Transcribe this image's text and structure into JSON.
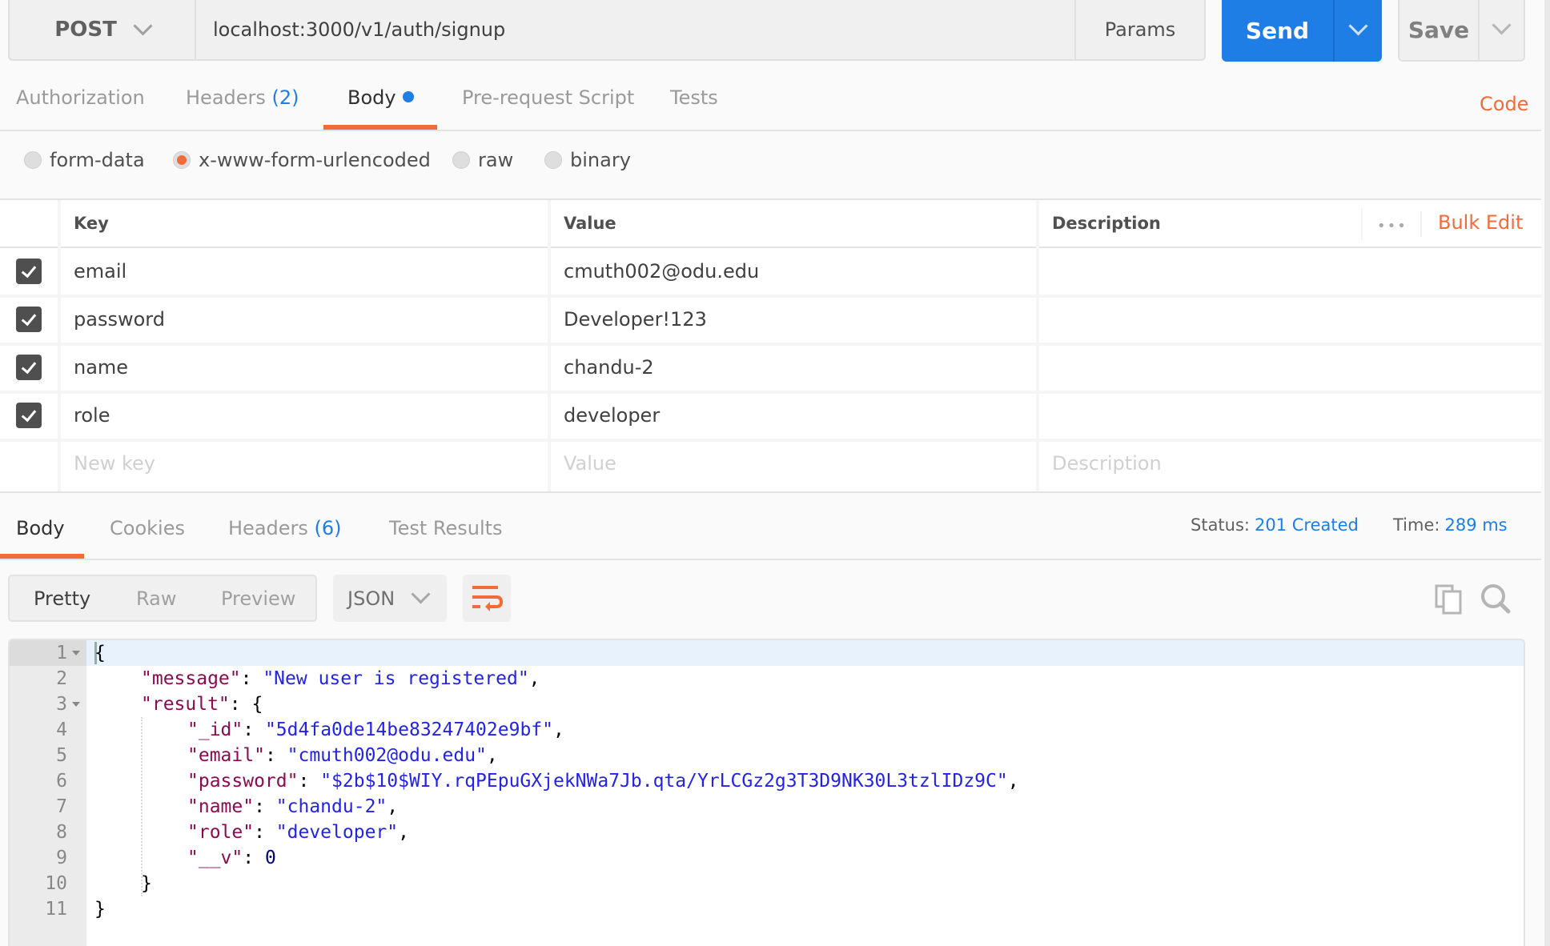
{
  "request": {
    "method": "POST",
    "url": "localhost:3000/v1/auth/signup",
    "params_label": "Params",
    "send_label": "Send",
    "save_label": "Save"
  },
  "request_tabs": [
    {
      "label": "Authorization"
    },
    {
      "label": "Headers",
      "count": "(2)"
    },
    {
      "label": "Body",
      "active": true
    },
    {
      "label": "Pre-request Script"
    },
    {
      "label": "Tests"
    }
  ],
  "code_link": "Code",
  "body_types": [
    {
      "label": "form-data",
      "selected": false
    },
    {
      "label": "x-www-form-urlencoded",
      "selected": true
    },
    {
      "label": "raw",
      "selected": false
    },
    {
      "label": "binary",
      "selected": false
    }
  ],
  "table": {
    "headers": {
      "key": "Key",
      "value": "Value",
      "description": "Description"
    },
    "more_label": "•••",
    "bulk_edit_label": "Bulk Edit",
    "rows": [
      {
        "checked": true,
        "key": "email",
        "value": "cmuth002@odu.edu",
        "description": ""
      },
      {
        "checked": true,
        "key": "password",
        "value": "Developer!123",
        "description": ""
      },
      {
        "checked": true,
        "key": "name",
        "value": "chandu-2",
        "description": ""
      },
      {
        "checked": true,
        "key": "role",
        "value": "developer",
        "description": ""
      }
    ],
    "new_row": {
      "key_placeholder": "New key",
      "value_placeholder": "Value",
      "description_placeholder": "Description"
    }
  },
  "response": {
    "tabs": [
      {
        "label": "Body",
        "active": true
      },
      {
        "label": "Cookies"
      },
      {
        "label": "Headers",
        "count": "(6)"
      },
      {
        "label": "Test Results"
      }
    ],
    "status_label": "Status:",
    "status_value": "201 Created",
    "time_label": "Time:",
    "time_value": "289 ms",
    "view_modes": [
      "Pretty",
      "Raw",
      "Preview"
    ],
    "active_view": "Pretty",
    "format": "JSON",
    "icons": [
      "wrap-lines-icon",
      "copy-icon",
      "search-icon"
    ],
    "code_lines": [
      {
        "n": "1",
        "fold": true
      },
      {
        "n": "2"
      },
      {
        "n": "3",
        "fold": true
      },
      {
        "n": "4"
      },
      {
        "n": "5"
      },
      {
        "n": "6"
      },
      {
        "n": "7"
      },
      {
        "n": "8"
      },
      {
        "n": "9"
      },
      {
        "n": "10"
      },
      {
        "n": "11"
      }
    ],
    "json": {
      "message_key": "\"message\"",
      "message_value": "\"New user is registered\"",
      "result_key": "\"result\"",
      "id_key": "\"_id\"",
      "id_value": "\"5d4fa0de14be83247402e9bf\"",
      "email_key": "\"email\"",
      "email_value": "\"cmuth002@odu.edu\"",
      "password_key": "\"password\"",
      "password_value": "\"$2b$10$WIY.rqPEpuGXjekNWa7Jb.qta/YrLCGz2g3T3D9NK30L3tzlIDz9C\"",
      "name_key": "\"name\"",
      "name_value": "\"chandu-2\"",
      "role_key": "\"role\"",
      "role_value": "\"developer\"",
      "v_key": "\"__v\"",
      "v_value": "0"
    }
  },
  "colors": {
    "accent": "#f26b3a",
    "primary": "#1f7de6"
  }
}
